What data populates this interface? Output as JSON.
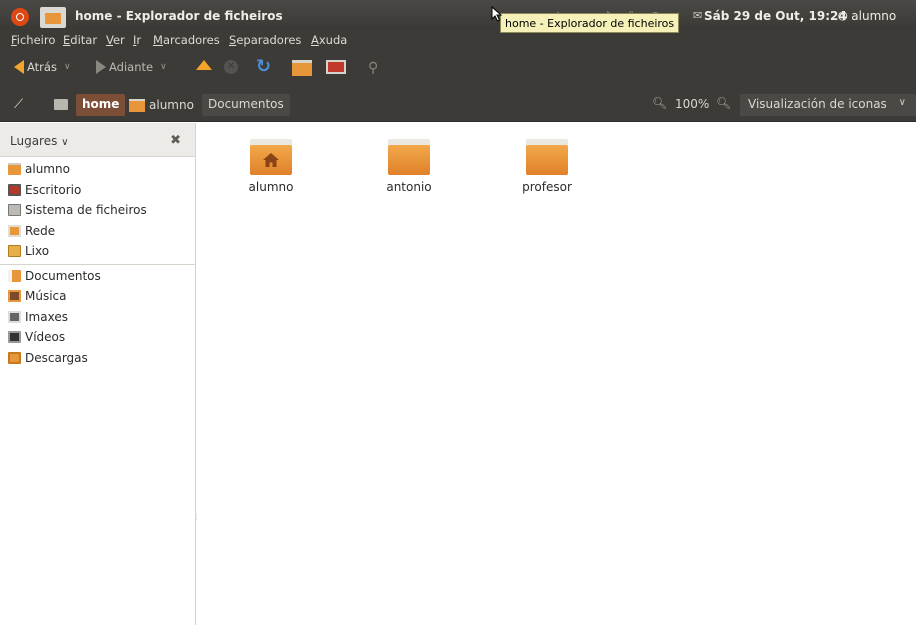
{
  "topbar": {
    "stray_text": "",
    "window_title": "home - Explorador de ficheiros",
    "tray_icons": "◇ ▭ ♪ ⎙ ◐ ",
    "clock_icon": "✉",
    "clock": "Sáb 29 de Out, 19:24",
    "user": "⏻ alumno",
    "tooltip": "home - Explorador de ficheiros"
  },
  "menubar": {
    "items": [
      "Ficheiro",
      "Editar",
      "Ver",
      "Ir",
      "Marcadores",
      "Separadores",
      "Axuda"
    ]
  },
  "toolbar": {
    "back_label": "Atrás",
    "forward_label": "Adiante"
  },
  "pathbar": {
    "crumbs": [
      "home",
      "alumno",
      "Documentos"
    ],
    "zoom_level": "100%",
    "view_mode": "Visualización de iconas"
  },
  "sidebar": {
    "header": "Lugares",
    "places": [
      "alumno",
      "Escritorio",
      "Sistema de ficheiros",
      "Rede",
      "Lixo"
    ],
    "bookmarks": [
      "Documentos",
      "Música",
      "Imaxes",
      "Vídeos",
      "Descargas"
    ]
  },
  "main": {
    "folders": [
      "alumno",
      "antonio",
      "profesor"
    ]
  },
  "colors": {
    "panel_dark": "#3c3b37",
    "accent_orange": "#e8963a",
    "active_crumb": "#7d4e37",
    "tooltip_bg": "#f5f1b8"
  }
}
